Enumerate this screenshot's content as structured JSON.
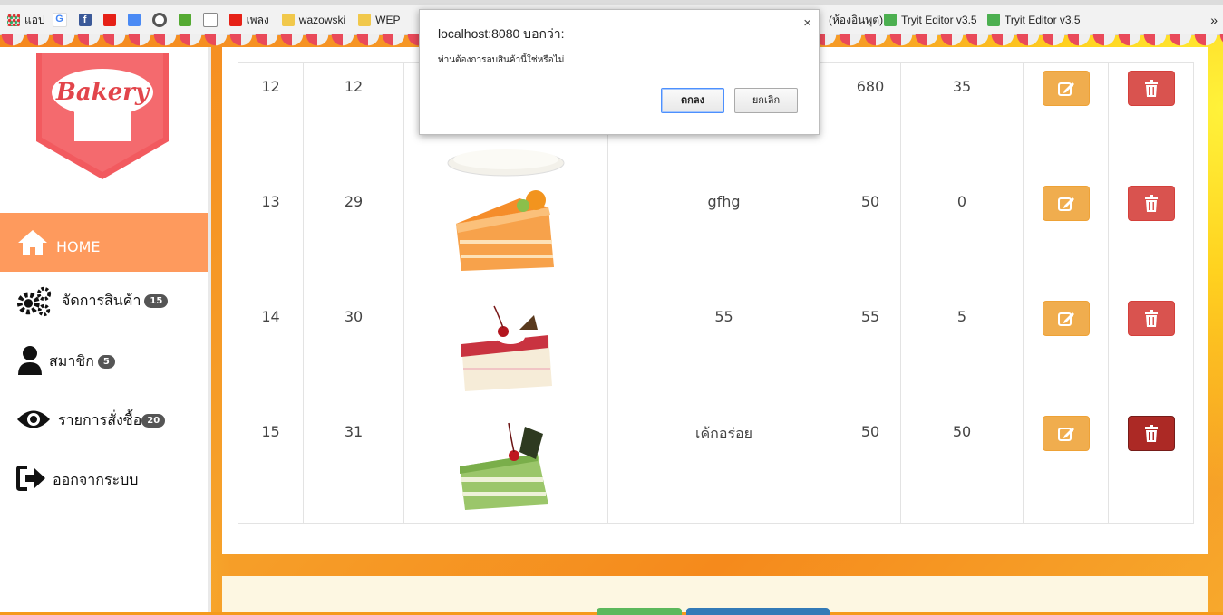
{
  "browser": {
    "bookmarks": [
      {
        "label": "แอป",
        "icon": "apps-icon"
      },
      {
        "label": "",
        "icon": "google-icon"
      },
      {
        "label": "",
        "icon": "facebook-icon"
      },
      {
        "label": "",
        "icon": "youtube-icon"
      },
      {
        "label": "",
        "icon": "translate-icon"
      },
      {
        "label": "",
        "icon": "ring-icon"
      },
      {
        "label": "",
        "icon": "square-app-icon"
      },
      {
        "label": "",
        "icon": "document-icon"
      },
      {
        "label": "เพลง",
        "icon": "youtube-icon"
      },
      {
        "label": "wazowski",
        "icon": "folder-icon"
      },
      {
        "label": "WEP",
        "icon": "folder-icon"
      }
    ],
    "bookmarks_right": [
      {
        "label": "(ห้องอินพุต)",
        "icon": ""
      },
      {
        "label": "Tryit Editor v3.5",
        "icon": "w3-icon"
      },
      {
        "label": "Tryit Editor v3.5",
        "icon": "w3-icon"
      }
    ],
    "more": "»"
  },
  "sidebar": {
    "logo_text": "Bakery",
    "items": [
      {
        "label": "HOME",
        "icon": "home-icon",
        "badge": ""
      },
      {
        "label": "จัดการสินค้า",
        "icon": "gears-icon",
        "badge": "15"
      },
      {
        "label": "สมาชิก",
        "icon": "user-icon",
        "badge": "5"
      },
      {
        "label": "รายการสั่งซื้อ",
        "icon": "eye-icon",
        "badge": "20"
      },
      {
        "label": "ออกจากระบบ",
        "icon": "sign-out-icon",
        "badge": ""
      }
    ]
  },
  "table": {
    "rows": [
      {
        "no": "12",
        "id": "12",
        "name": "",
        "price": "680",
        "stock": "35",
        "image": "coconut-cake"
      },
      {
        "no": "13",
        "id": "29",
        "name": "gfhg",
        "price": "50",
        "stock": "0",
        "image": "orange-cake"
      },
      {
        "no": "14",
        "id": "30",
        "name": "55",
        "price": "55",
        "stock": "5",
        "image": "strawberry-cake"
      },
      {
        "no": "15",
        "id": "31",
        "name": "เค้กอร่อย",
        "price": "50",
        "stock": "50",
        "image": "pandan-cake"
      }
    ]
  },
  "dialog": {
    "title": "localhost:8080 บอกว่า:",
    "message": "ท่านต้องการลบสินค้านี้ใช่หรือไม่",
    "ok_label": "ตกลง",
    "cancel_label": "ยกเลิก",
    "close": "×"
  },
  "colors": {
    "active_nav": "#fe9a5d",
    "edit_button": "#f0ad4e",
    "delete_button": "#d9534f",
    "delete_pressed": "#ac2925"
  }
}
